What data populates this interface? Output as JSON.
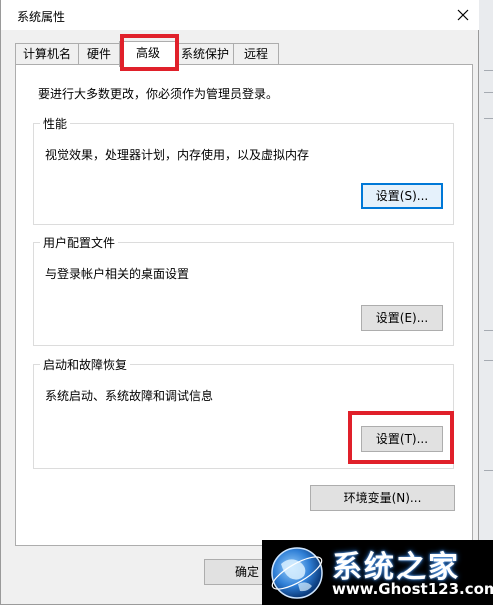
{
  "window": {
    "title": "系统属性"
  },
  "tabs": [
    {
      "label": "计算机名"
    },
    {
      "label": "硬件"
    },
    {
      "label": "高级"
    },
    {
      "label": "系统保护"
    },
    {
      "label": "远程"
    }
  ],
  "active_tab": "高级",
  "advanced": {
    "admin_note": "要进行大多数更改，你必须作为管理员登录。",
    "performance": {
      "title": "性能",
      "description": "视觉效果，处理器计划，内存使用，以及虚拟内存",
      "button": "设置(S)..."
    },
    "user_profiles": {
      "title": "用户配置文件",
      "description": "与登录帐户相关的桌面设置",
      "button": "设置(E)..."
    },
    "startup_recovery": {
      "title": "启动和故障恢复",
      "description": "系统启动、系统故障和调试信息",
      "button": "设置(T)..."
    },
    "env_button": "环境变量(N)..."
  },
  "footer": {
    "ok_label": "确定"
  },
  "watermark": {
    "title": "系统之家",
    "url": "www.Ghost123.com"
  },
  "colors": {
    "highlight": "#e0202a",
    "focus_border": "#0078d7"
  }
}
